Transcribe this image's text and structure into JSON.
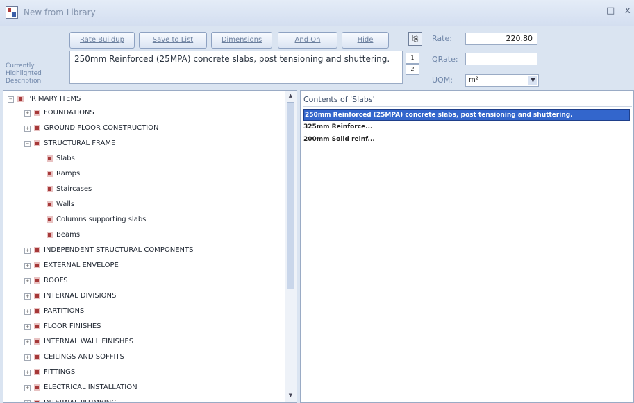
{
  "window": {
    "title": "New from Library",
    "minimize": "_",
    "maximize": "□",
    "close": "x"
  },
  "toolbar": {
    "rate_buildup": "Rate Buildup",
    "save_to_list": "Save to List",
    "dimensions": "Dimensions",
    "and_on": "And On",
    "hide": "Hide"
  },
  "description": {
    "label": "Currently Highlighted Description",
    "text": "250mm Reinforced (25MPA) concrete slabs, post tensioning and shuttering."
  },
  "spin": {
    "up": "1",
    "down": "2"
  },
  "fields": {
    "rate_label": "Rate:",
    "rate_value": "220.80",
    "qrate_label": "QRate:",
    "qrate_value": "",
    "uom_label": "UOM:",
    "uom_value": "m²"
  },
  "tree": {
    "root": "PRIMARY ITEMS",
    "rows": [
      {
        "label": "FOUNDATIONS",
        "expander": "+"
      },
      {
        "label": "GROUND FLOOR CONSTRUCTION",
        "expander": "+"
      },
      {
        "label": "STRUCTURAL FRAME",
        "expander": "−"
      },
      {
        "label": "Slabs",
        "expander": ""
      },
      {
        "label": "Ramps",
        "expander": ""
      },
      {
        "label": "Staircases",
        "expander": ""
      },
      {
        "label": "Walls",
        "expander": ""
      },
      {
        "label": "Columns supporting slabs",
        "expander": ""
      },
      {
        "label": "Beams",
        "expander": ""
      },
      {
        "label": "INDEPENDENT STRUCTURAL COMPONENTS",
        "expander": "+"
      },
      {
        "label": "EXTERNAL ENVELOPE",
        "expander": "+"
      },
      {
        "label": "ROOFS",
        "expander": "+"
      },
      {
        "label": "INTERNAL DIVISIONS",
        "expander": "+"
      },
      {
        "label": "PARTITIONS",
        "expander": "+"
      },
      {
        "label": "FLOOR FINISHES",
        "expander": "+"
      },
      {
        "label": "INTERNAL WALL FINISHES",
        "expander": "+"
      },
      {
        "label": "CEILINGS AND SOFFITS",
        "expander": "+"
      },
      {
        "label": "FITTINGS",
        "expander": "+"
      },
      {
        "label": "ELECTRICAL INSTALLATION",
        "expander": "+"
      },
      {
        "label": "INTERNAL PLUMBING",
        "expander": "+"
      }
    ]
  },
  "contents": {
    "header": "Contents of 'Slabs'",
    "items": [
      "250mm Reinforced (25MPA) concrete slabs, post tensioning and shuttering.",
      "325mm Reinforce...",
      "200mm Solid reinf..."
    ]
  },
  "colors": {
    "selection": "#3366cc",
    "folder": "#a63838",
    "window_bg": "#dae4f1"
  }
}
